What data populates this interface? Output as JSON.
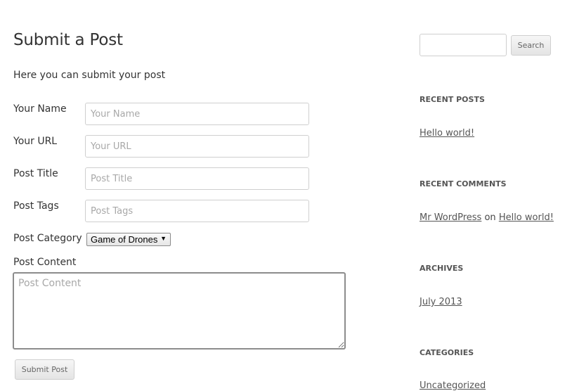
{
  "page": {
    "title": "Submit a Post",
    "intro": "Here you can submit your post"
  },
  "form": {
    "fields": [
      {
        "label": "Your Name",
        "placeholder": "Your Name",
        "value": ""
      },
      {
        "label": "Your URL",
        "placeholder": "Your URL",
        "value": ""
      },
      {
        "label": "Post Title",
        "placeholder": "Post Title",
        "value": ""
      },
      {
        "label": "Post Tags",
        "placeholder": "Post Tags",
        "value": ""
      }
    ],
    "category": {
      "label": "Post Category",
      "selected": "Game of Drones",
      "arrow": "▼"
    },
    "content": {
      "label": "Post Content",
      "placeholder": "Post Content",
      "value": ""
    },
    "submit_label": "Submit Post"
  },
  "sidebar": {
    "search": {
      "value": "",
      "button_label": "Search"
    },
    "recent_posts": {
      "title": "RECENT POSTS",
      "items": [
        "Hello world!"
      ]
    },
    "recent_comments": {
      "title": "RECENT COMMENTS",
      "author": "Mr WordPress",
      "connector": "on",
      "post": "Hello world!"
    },
    "archives": {
      "title": "ARCHIVES",
      "items": [
        "July 2013"
      ]
    },
    "categories": {
      "title": "CATEGORIES",
      "items": [
        "Uncategorized"
      ]
    }
  }
}
